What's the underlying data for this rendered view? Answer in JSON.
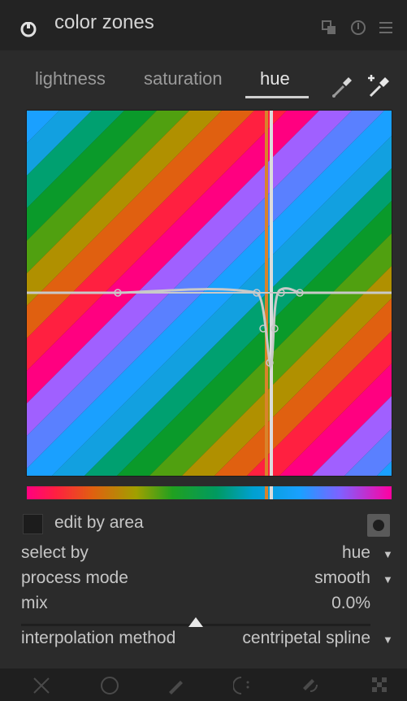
{
  "header": {
    "title": "color zones",
    "icons": [
      "power-icon",
      "presets-icon",
      "reset-icon",
      "menu-icon"
    ]
  },
  "tabs": [
    {
      "label": "lightness",
      "active": false
    },
    {
      "label": "saturation",
      "active": false
    },
    {
      "label": "hue",
      "active": true
    }
  ],
  "pickers": [
    "color-picker-icon",
    "color-picker-set-area-icon"
  ],
  "controls": {
    "edit_by_area_label": "edit by area",
    "select_by_label": "select by",
    "select_by_value": "hue",
    "process_mode_label": "process mode",
    "process_mode_value": "smooth",
    "mix_label": "mix",
    "mix_value": "0.0%",
    "interpolation_label": "interpolation method",
    "interpolation_value": "centripetal spline"
  },
  "footer_icons": [
    "no-mask-icon",
    "uniform-mask-icon",
    "drawn-mask-icon",
    "parametric-mask-icon",
    "drawn-parametric-mask-icon",
    "raster-mask-icon"
  ],
  "colors": {
    "background": "#2b2b2b",
    "header": "#232323",
    "text": "#c6c6c6",
    "curve": "#c8c8c8"
  }
}
